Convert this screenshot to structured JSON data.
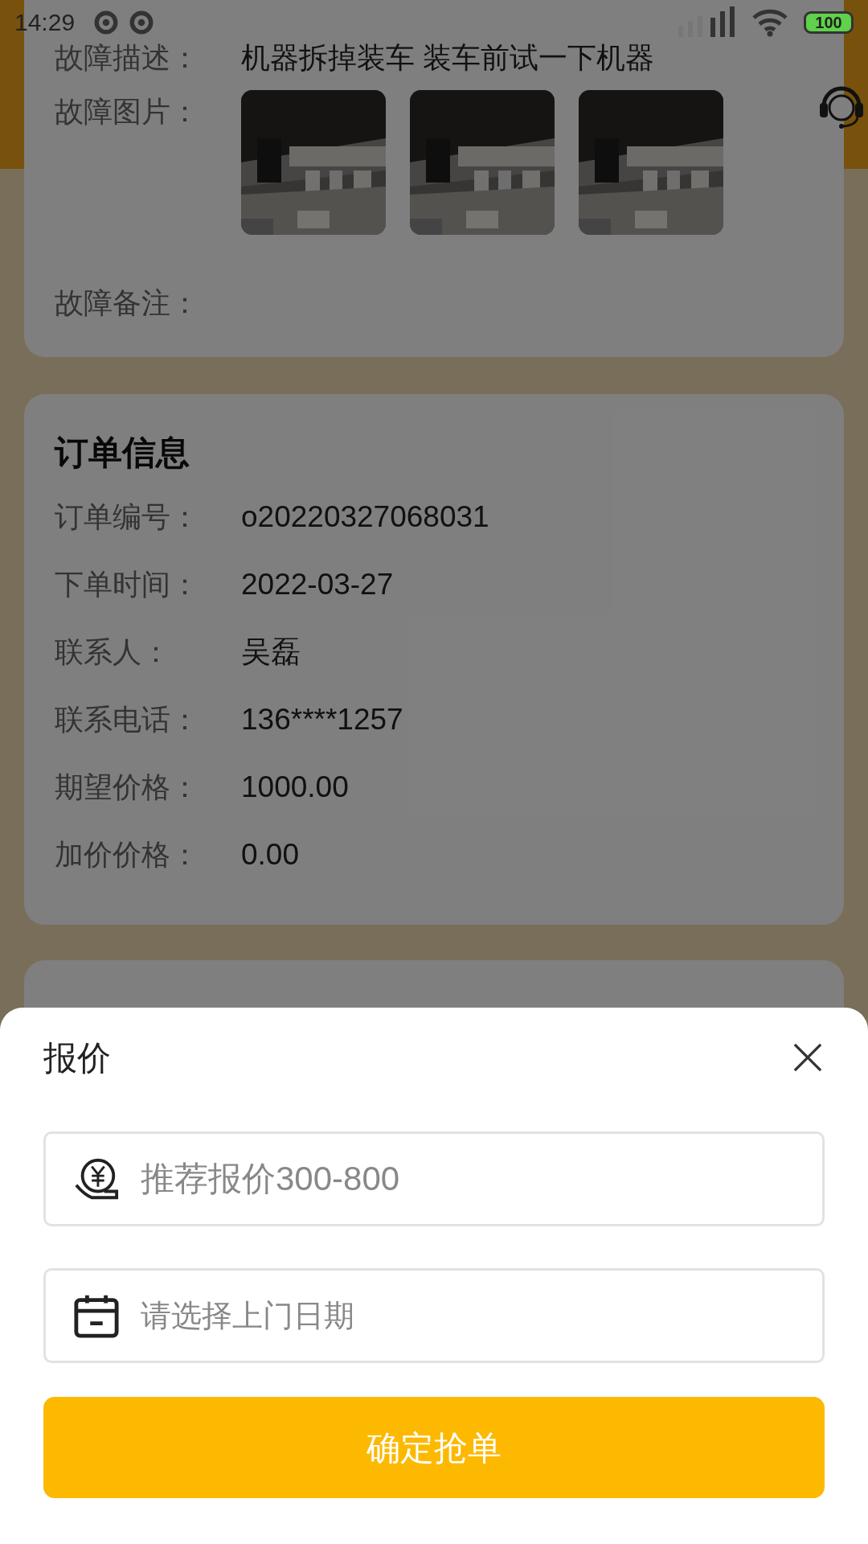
{
  "status_bar": {
    "time": "14:29",
    "battery": "100"
  },
  "fault_card": {
    "description": {
      "label": "故障描述：",
      "value": "机器拆掉装车 装车前试一下机器"
    },
    "photos": {
      "label": "故障图片："
    },
    "remark": {
      "label": "故障备注："
    }
  },
  "order_card": {
    "title": "订单信息",
    "rows": [
      {
        "label": "订单编号：",
        "value": "o20220327068031"
      },
      {
        "label": "下单时间：",
        "value": "2022-03-27"
      },
      {
        "label": "联系人：",
        "value": "吴磊"
      },
      {
        "label": "联系电话：",
        "value": "136****1257"
      },
      {
        "label": "期望价格：",
        "value": "1000.00"
      },
      {
        "label": "加价价格：",
        "value": "0.00"
      }
    ]
  },
  "quote_sheet": {
    "title": "报价",
    "price_field": {
      "placeholder": "推荐报价300-800"
    },
    "date_field": {
      "placeholder": "请选择上门日期"
    },
    "submit_button": "确定抢单"
  }
}
